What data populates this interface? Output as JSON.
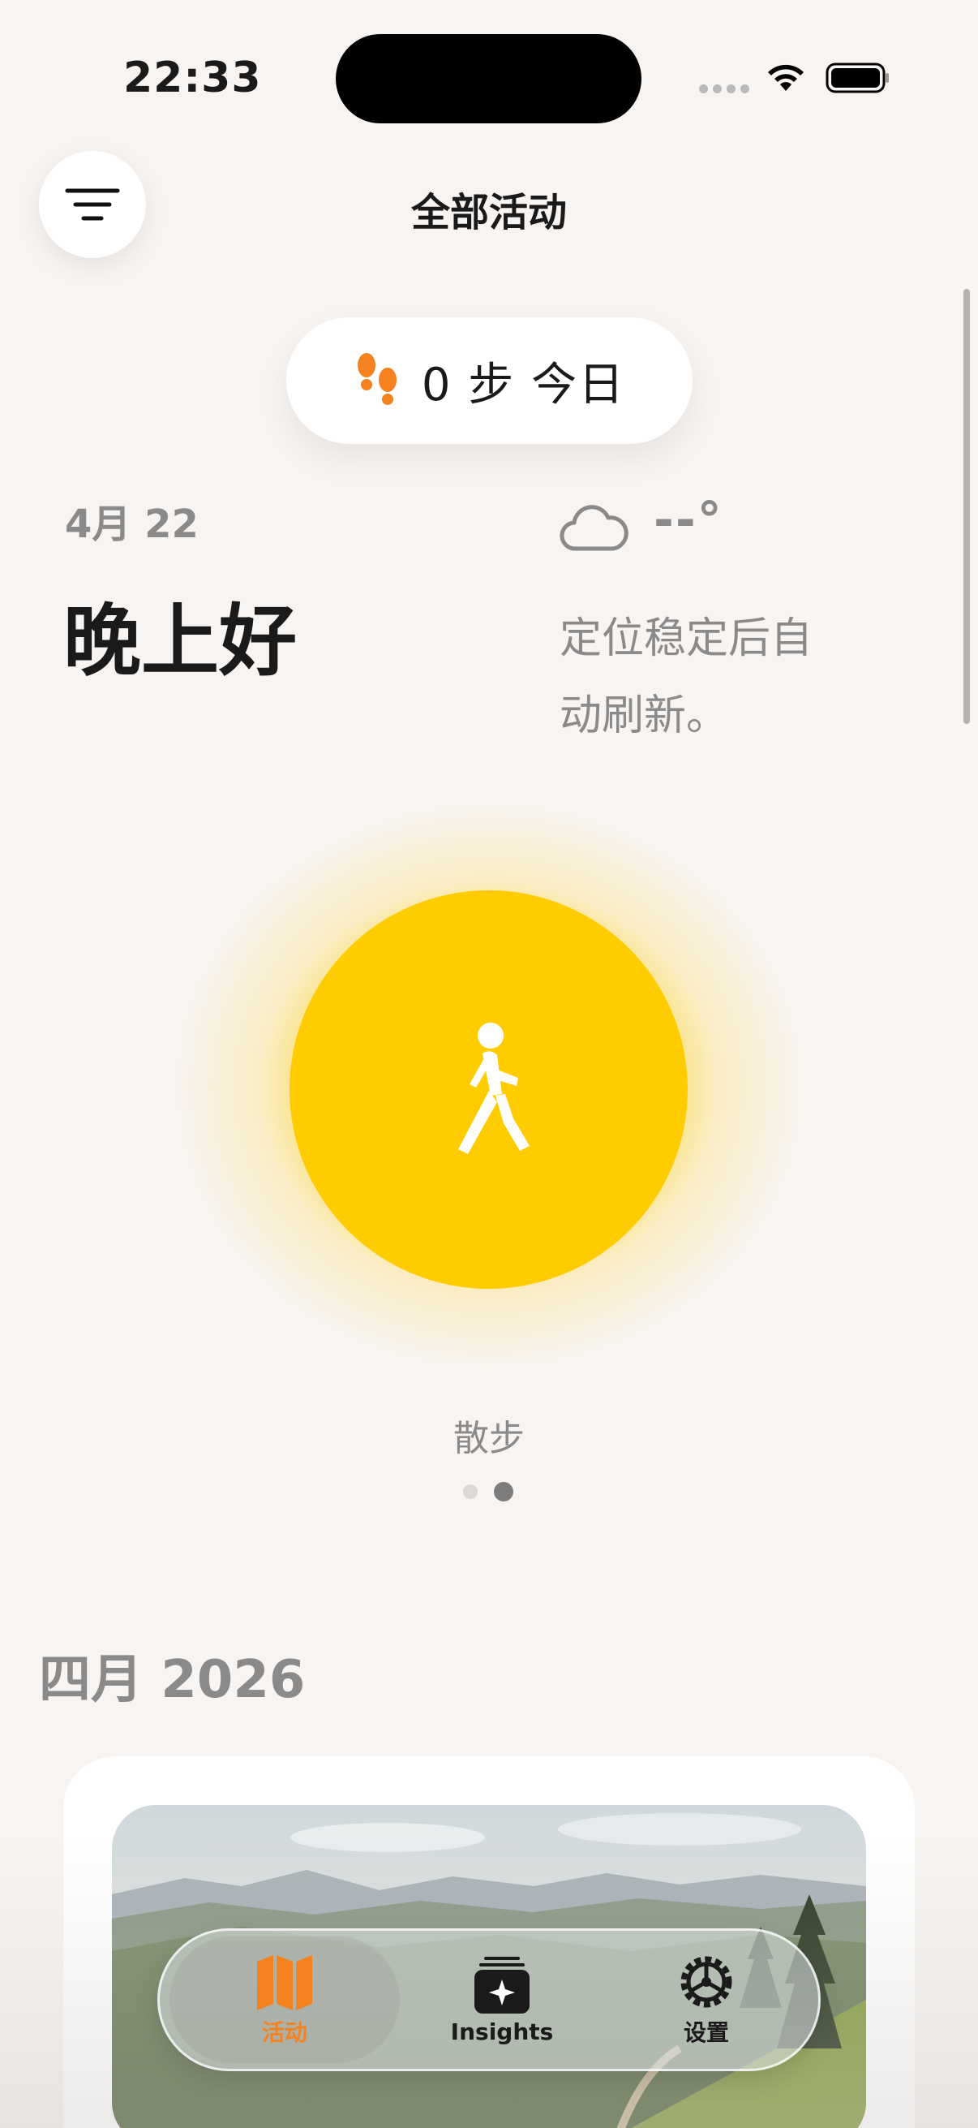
{
  "status_bar": {
    "time": "22:33"
  },
  "header": {
    "title": "全部活动"
  },
  "steps": {
    "text": "0 步 今日"
  },
  "greeting": {
    "date": "4月 22",
    "text": "晚上好"
  },
  "weather": {
    "temperature": "--°",
    "message": "定位稳定后自动刷新。",
    "icon": "cloud-icon"
  },
  "activity": {
    "label": "散步",
    "icon": "walking-person-icon",
    "color": "#ffcc00",
    "pages": 2,
    "current_page": 2
  },
  "timeline": {
    "month": "四月 2026"
  },
  "tabbar": {
    "tabs": [
      {
        "label": "活动",
        "icon": "map-icon",
        "selected": true
      },
      {
        "label": "Insights",
        "icon": "insights-icon",
        "selected": false
      },
      {
        "label": "设置",
        "icon": "gear-icon",
        "selected": false
      }
    ]
  },
  "colors": {
    "accent": "#f5821f",
    "activity": "#ffcc00",
    "background": "#f8f4f1"
  }
}
